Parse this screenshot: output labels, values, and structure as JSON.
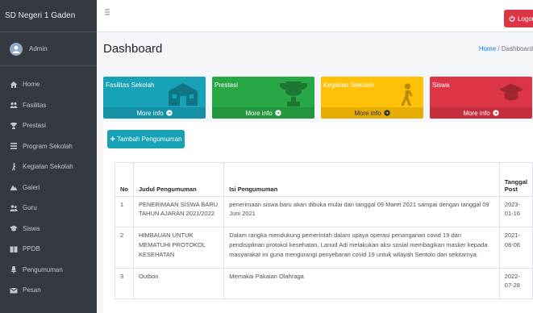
{
  "sidebar": {
    "brand": "SD Negeri 1 Gaden",
    "user": "Admin",
    "items": [
      {
        "label": "Home",
        "icon": "home-icon"
      },
      {
        "label": "Fasilitas",
        "icon": "users-icon"
      },
      {
        "label": "Prestasi",
        "icon": "trophy-icon"
      },
      {
        "label": "Program Sekolah",
        "icon": "list-icon"
      },
      {
        "label": "Kegiatan Sekolah",
        "icon": "walking-icon"
      },
      {
        "label": "Galeri",
        "icon": "mountain-icon"
      },
      {
        "label": "Guru",
        "icon": "user-friends-icon"
      },
      {
        "label": "Siswa",
        "icon": "graduation-cap-icon"
      },
      {
        "label": "PPDB",
        "icon": "book-icon"
      },
      {
        "label": "Pengumuman",
        "icon": "bullhorn-icon"
      },
      {
        "label": "Pesan",
        "icon": "envelope-icon"
      }
    ]
  },
  "topbar": {
    "logout_label": "Logout"
  },
  "header": {
    "title": "Dashboard",
    "breadcrumb": {
      "home": "Home",
      "separator": "/",
      "current": "Dashboard"
    }
  },
  "boxes": [
    {
      "label": "Fasilitas Sekolah",
      "footer": "More info",
      "color": "#17a2b8",
      "icon": "school-icon"
    },
    {
      "label": "Prestasi",
      "footer": "More info",
      "color": "#28a745",
      "icon": "trophy-icon"
    },
    {
      "label": "Kegiatan Sekolah",
      "footer": "More info",
      "color": "#ffc107",
      "icon": "walking-icon"
    },
    {
      "label": "Siswa",
      "footer": "More info",
      "color": "#dc3545",
      "icon": "graduation-cap-icon"
    }
  ],
  "announcements": {
    "add_button": "Tambah Pengumuman",
    "columns": [
      "No",
      "Judul Pengumuman",
      "Isi Pengumuman",
      "Tanggal Post"
    ],
    "rows": [
      {
        "no": "1",
        "judul": "PENERIMAAN SISWA BARU TAHUN AJARAN 2021/2022",
        "isi": "penerimaan siswa baru akan dibuka mulai dari tanggal 09 Maret 2021 sampai dengan tanggal 09 Juni 2021",
        "tanggal": "2023-01-16"
      },
      {
        "no": "2",
        "judul": "HIMBAUAN UNTUK MEMATUHI PROTOKOL KESEHATAN",
        "isi": "Dalam rangka mendukung pemerintah dalam upaya operasi penanganan covid 19 dan pendisiplinan protokol kesehatan, Lanud Adi melakukan aksi sosial membagikan masker kepada masyarakat ini guna mengurangi penyebaran covid 19 untuk wilayah Sentolo dan sekitarnya.",
        "tanggal": "2021-08-06"
      },
      {
        "no": "3",
        "judul": "Outbon",
        "isi": "Memakai Pakaian Olahraga",
        "tanggal": "2022-07-28"
      }
    ]
  }
}
